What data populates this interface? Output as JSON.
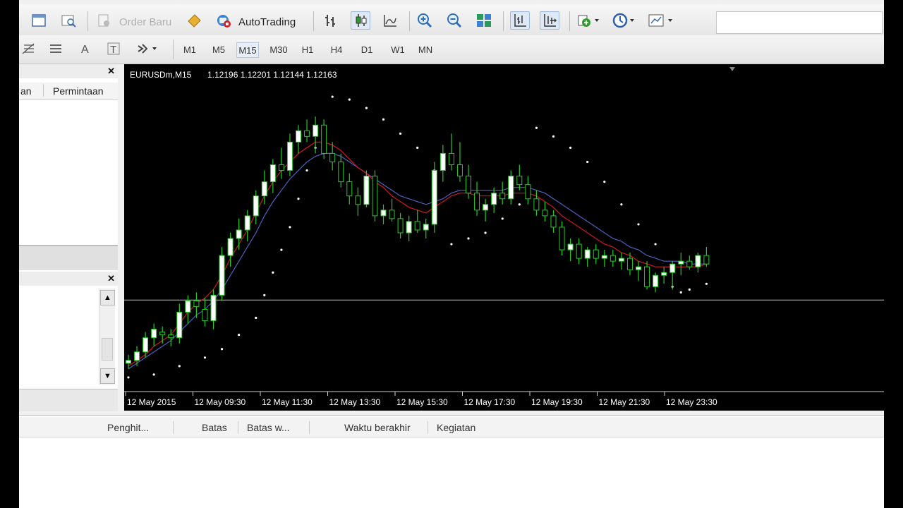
{
  "toolbar": {
    "order_baru_label": "Order Baru",
    "autotrading_label": "AutoTrading",
    "timeframes": [
      "M1",
      "M5",
      "M15",
      "M30",
      "H1",
      "H4",
      "D1",
      "W1",
      "MN"
    ],
    "active_timeframe": "M15"
  },
  "left_panel": {
    "tab_partial": "an",
    "tab_permintaan": "Permintaan"
  },
  "chart": {
    "symbol": "EURUSDm,M15",
    "ohlc": "1.12196 1.12201 1.12144 1.12163",
    "time_labels": [
      "12 May 2015",
      "12 May 09:30",
      "12 May 11:30",
      "12 May 13:30",
      "12 May 15:30",
      "12 May 17:30",
      "12 May 19:30",
      "12 May 21:30",
      "12 May 23:30"
    ],
    "colors": {
      "background": "#000000",
      "candle": "#22cc22",
      "bull_body": "#ffffff",
      "ma_red": "#d01820",
      "ma_blue": "#5060c0",
      "sar": "#ffffff",
      "price_line": "#c0c0c0"
    }
  },
  "chart_data": {
    "type": "candlestick",
    "symbol": "EURUSDm",
    "timeframe": "M15",
    "candles": [
      [
        1.1194,
        1.1197,
        1.1192,
        1.1195
      ],
      [
        1.1195,
        1.12,
        1.1193,
        1.1198
      ],
      [
        1.1198,
        1.1205,
        1.1196,
        1.1203
      ],
      [
        1.1203,
        1.1208,
        1.12,
        1.1206
      ],
      [
        1.1205,
        1.1207,
        1.1201,
        1.1204
      ],
      [
        1.1204,
        1.1206,
        1.12,
        1.1203
      ],
      [
        1.1203,
        1.1215,
        1.1201,
        1.1212
      ],
      [
        1.1212,
        1.1218,
        1.1208,
        1.1216
      ],
      [
        1.1216,
        1.1219,
        1.121,
        1.1214
      ],
      [
        1.1213,
        1.1217,
        1.1207,
        1.1209
      ],
      [
        1.1209,
        1.122,
        1.1206,
        1.1218
      ],
      [
        1.1218,
        1.1235,
        1.1216,
        1.1232
      ],
      [
        1.1232,
        1.124,
        1.1228,
        1.1238
      ],
      [
        1.1238,
        1.1245,
        1.1234,
        1.1241
      ],
      [
        1.1241,
        1.1248,
        1.1237,
        1.1246
      ],
      [
        1.1246,
        1.1255,
        1.1243,
        1.1253
      ],
      [
        1.1253,
        1.1262,
        1.125,
        1.1258
      ],
      [
        1.1258,
        1.1266,
        1.1254,
        1.1264
      ],
      [
        1.1264,
        1.127,
        1.1259,
        1.1262
      ],
      [
        1.1262,
        1.1275,
        1.126,
        1.1272
      ],
      [
        1.1272,
        1.1278,
        1.1268,
        1.1276
      ],
      [
        1.1276,
        1.128,
        1.1272,
        1.1274
      ],
      [
        1.1274,
        1.1281,
        1.1268,
        1.1278
      ],
      [
        1.1278,
        1.128,
        1.1266,
        1.1268
      ],
      [
        1.1268,
        1.1272,
        1.1262,
        1.1265
      ],
      [
        1.1265,
        1.1268,
        1.1256,
        1.1258
      ],
      [
        1.1258,
        1.1261,
        1.125,
        1.1253
      ],
      [
        1.1253,
        1.1256,
        1.1246,
        1.125
      ],
      [
        1.125,
        1.1262,
        1.1249,
        1.126
      ],
      [
        1.126,
        1.1262,
        1.1244,
        1.1246
      ],
      [
        1.1246,
        1.125,
        1.1243,
        1.1248
      ],
      [
        1.1248,
        1.1252,
        1.1244,
        1.1245
      ],
      [
        1.1245,
        1.1247,
        1.1238,
        1.124
      ],
      [
        1.124,
        1.1246,
        1.1237,
        1.1244
      ],
      [
        1.1244,
        1.1248,
        1.124,
        1.1241
      ],
      [
        1.1241,
        1.1245,
        1.1238,
        1.1243
      ],
      [
        1.1243,
        1.1265,
        1.124,
        1.1262
      ],
      [
        1.1262,
        1.1271,
        1.1258,
        1.1268
      ],
      [
        1.1268,
        1.1275,
        1.1262,
        1.1264
      ],
      [
        1.1264,
        1.1272,
        1.1258,
        1.126
      ],
      [
        1.126,
        1.1264,
        1.1252,
        1.1254
      ],
      [
        1.1254,
        1.1258,
        1.1246,
        1.1248
      ],
      [
        1.1248,
        1.1252,
        1.1244,
        1.125
      ],
      [
        1.125,
        1.1256,
        1.1247,
        1.1254
      ],
      [
        1.1254,
        1.1258,
        1.125,
        1.1252
      ],
      [
        1.1252,
        1.1262,
        1.125,
        1.126
      ],
      [
        1.126,
        1.1264,
        1.1255,
        1.1257
      ],
      [
        1.1257,
        1.126,
        1.125,
        1.1252
      ],
      [
        1.1252,
        1.1255,
        1.1246,
        1.1248
      ],
      [
        1.1248,
        1.1251,
        1.1244,
        1.1246
      ],
      [
        1.1246,
        1.1248,
        1.124,
        1.1242
      ],
      [
        1.1242,
        1.1244,
        1.1232,
        1.1234
      ],
      [
        1.1234,
        1.1238,
        1.123,
        1.1236
      ],
      [
        1.1236,
        1.1238,
        1.1229,
        1.1231
      ],
      [
        1.1231,
        1.1235,
        1.1228,
        1.1234
      ],
      [
        1.1234,
        1.1236,
        1.1229,
        1.1231
      ],
      [
        1.1231,
        1.1234,
        1.1228,
        1.1232
      ],
      [
        1.1232,
        1.1234,
        1.1228,
        1.123
      ],
      [
        1.123,
        1.1233,
        1.1227,
        1.1231
      ],
      [
        1.1231,
        1.1233,
        1.1225,
        1.1227
      ],
      [
        1.1227,
        1.123,
        1.1223,
        1.1228
      ],
      [
        1.1228,
        1.123,
        1.122,
        1.1221
      ],
      [
        1.1221,
        1.1226,
        1.1219,
        1.1225
      ],
      [
        1.1225,
        1.1228,
        1.1222,
        1.1226
      ],
      [
        1.1226,
        1.123,
        1.122,
        1.1229
      ],
      [
        1.1229,
        1.1233,
        1.1225,
        1.123
      ],
      [
        1.123,
        1.1232,
        1.1227,
        1.1228
      ],
      [
        1.1228,
        1.1233,
        1.1226,
        1.1232
      ],
      [
        1.1232,
        1.1235,
        1.1228,
        1.1229
      ]
    ],
    "ma_fast": [
      1.1193,
      1.1195,
      1.1197,
      1.12,
      1.1202,
      1.1204,
      1.1208,
      1.1212,
      1.1215,
      1.1217,
      1.122,
      1.1225,
      1.1231,
      1.1236,
      1.1241,
      1.1247,
      1.1253,
      1.1258,
      1.1262,
      1.1265,
      1.1268,
      1.127,
      1.1272,
      1.1272,
      1.1271,
      1.1269,
      1.1266,
      1.1263,
      1.1261,
      1.1258,
      1.1256,
      1.1253,
      1.1251,
      1.1249,
      1.1248,
      1.1247,
      1.1249,
      1.1251,
      1.1253,
      1.1254,
      1.1254,
      1.1253,
      1.1253,
      1.1253,
      1.1253,
      1.1254,
      1.1254,
      1.1254,
      1.1253,
      1.1251,
      1.1249,
      1.1246,
      1.1244,
      1.1242,
      1.124,
      1.1238,
      1.1236,
      1.1235,
      1.1233,
      1.1232,
      1.123,
      1.1229,
      1.1228,
      1.1228,
      1.1228,
      1.1228,
      1.1228,
      1.1228,
      1.1229
    ],
    "ma_slow": [
      1.1192,
      1.1194,
      1.1196,
      1.1198,
      1.12,
      1.1202,
      1.1205,
      1.1208,
      1.1211,
      1.1213,
      1.1216,
      1.122,
      1.1225,
      1.123,
      1.1235,
      1.124,
      1.1246,
      1.1251,
      1.1255,
      1.1259,
      1.1262,
      1.1265,
      1.1267,
      1.1268,
      1.1268,
      1.1267,
      1.1265,
      1.1263,
      1.1261,
      1.1259,
      1.1257,
      1.1255,
      1.1253,
      1.1252,
      1.1251,
      1.125,
      1.1251,
      1.1252,
      1.1254,
      1.1255,
      1.1255,
      1.1255,
      1.1255,
      1.1255,
      1.1255,
      1.1256,
      1.1256,
      1.1256,
      1.1255,
      1.1254,
      1.1252,
      1.125,
      1.1248,
      1.1246,
      1.1244,
      1.1242,
      1.124,
      1.1238,
      1.1237,
      1.1235,
      1.1234,
      1.1232,
      1.1231,
      1.123,
      1.123,
      1.123,
      1.1229,
      1.1229,
      1.1229
    ],
    "sar": [
      [
        0,
        1.1189
      ],
      [
        3,
        1.119
      ],
      [
        6,
        1.1193
      ],
      [
        9,
        1.1196
      ],
      [
        11,
        1.1199
      ],
      [
        13,
        1.1204
      ],
      [
        15,
        1.121
      ],
      [
        16,
        1.1218
      ],
      [
        17,
        1.1226
      ],
      [
        18,
        1.1234
      ],
      [
        19,
        1.1242
      ],
      [
        20,
        1.1252
      ],
      [
        21,
        1.1262
      ],
      [
        22,
        1.127
      ],
      [
        24,
        1.1288
      ],
      [
        26,
        1.1287
      ],
      [
        28,
        1.1284
      ],
      [
        30,
        1.128
      ],
      [
        32,
        1.1275
      ],
      [
        34,
        1.127
      ],
      [
        36,
        1.1262
      ],
      [
        38,
        1.1236
      ],
      [
        40,
        1.1238
      ],
      [
        42,
        1.124
      ],
      [
        44,
        1.1245
      ],
      [
        46,
        1.125
      ],
      [
        48,
        1.1277
      ],
      [
        50,
        1.1274
      ],
      [
        52,
        1.127
      ],
      [
        54,
        1.1265
      ],
      [
        56,
        1.1258
      ],
      [
        58,
        1.125
      ],
      [
        60,
        1.1243
      ],
      [
        62,
        1.1236
      ],
      [
        64,
        1.1221
      ],
      [
        65,
        1.1219
      ],
      [
        66,
        1.122
      ],
      [
        68,
        1.1222
      ]
    ],
    "price_line": 1.12163,
    "xlabel": "",
    "ylabel": ""
  },
  "bottom_panel": {
    "tabs": [
      "Penghit...",
      "Batas",
      "Batas w...",
      "Waktu berakhir",
      "Kegiatan"
    ]
  }
}
